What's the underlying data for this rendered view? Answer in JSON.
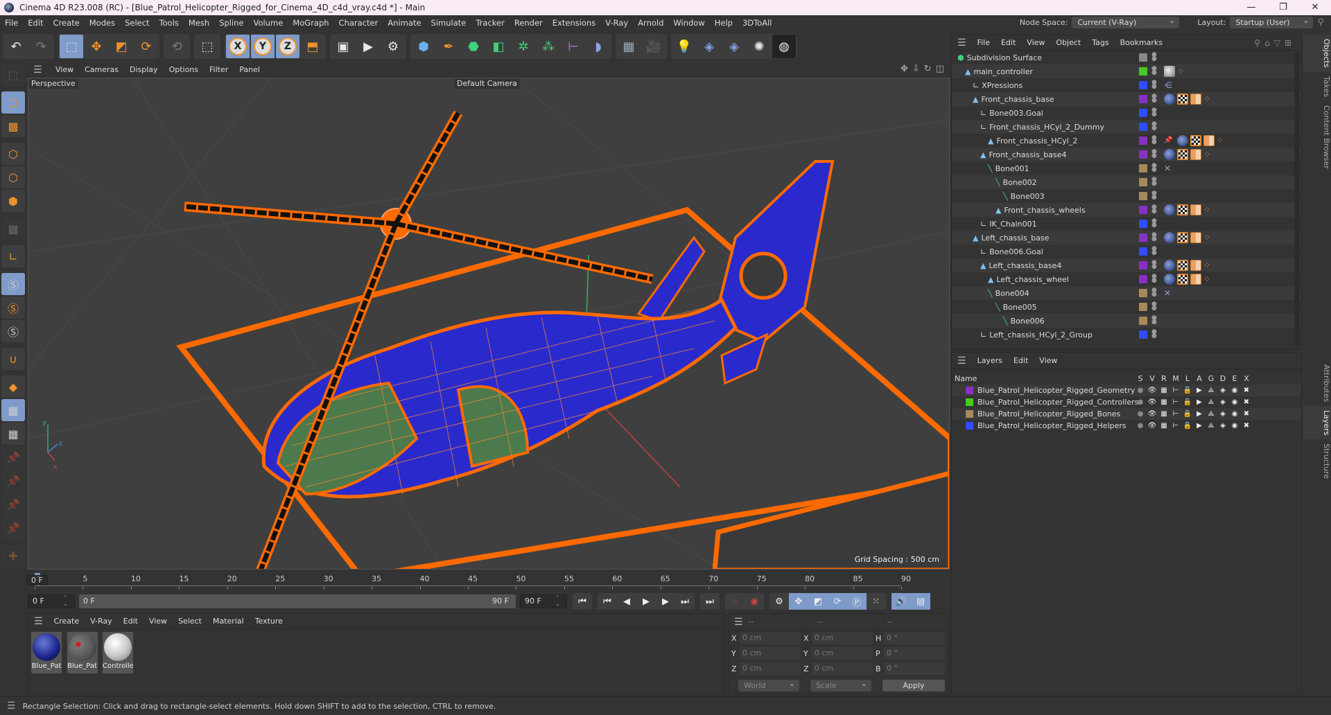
{
  "titlebar": {
    "title": "Cinema 4D R23.008 (RC) - [Blue_Patrol_Helicopter_Rigged_for_Cinema_4D_c4d_vray.c4d *] - Main",
    "minimize": "—",
    "maximize": "❐",
    "close": "✕"
  },
  "menubar": {
    "items": [
      "File",
      "Edit",
      "Create",
      "Modes",
      "Select",
      "Tools",
      "Mesh",
      "Spline",
      "Volume",
      "MoGraph",
      "Character",
      "Animate",
      "Simulate",
      "Tracker",
      "Render",
      "Extensions",
      "V-Ray",
      "Arnold",
      "Window",
      "Help",
      "3DToAll"
    ],
    "node_space_label": "Node Space:",
    "node_space_value": "Current (V-Ray)",
    "layout_label": "Layout:",
    "layout_value": "Startup (User)"
  },
  "viewport": {
    "menu": [
      "View",
      "Cameras",
      "Display",
      "Options",
      "Filter",
      "Panel"
    ],
    "view_name": "Perspective",
    "camera": "Default Camera",
    "grid_spacing": "Grid Spacing : 500 cm"
  },
  "timeline": {
    "ticks": [
      "0",
      "5",
      "10",
      "15",
      "20",
      "25",
      "30",
      "35",
      "40",
      "45",
      "50",
      "55",
      "60",
      "65",
      "70",
      "75",
      "80",
      "85",
      "90"
    ],
    "current_frame_right": "0 F",
    "start_field": "0 F",
    "range_start": "0 F",
    "range_end": "90 F",
    "end_field": "90 F"
  },
  "material_panel": {
    "menu": [
      "Create",
      "V-Ray",
      "Edit",
      "View",
      "Select",
      "Material",
      "Texture"
    ],
    "materials": [
      {
        "name": "Blue_Pat",
        "style": "blue"
      },
      {
        "name": "Blue_Pat",
        "style": "gray-red"
      },
      {
        "name": "Controlle",
        "style": "white"
      }
    ]
  },
  "coordinates": {
    "headers": [
      "--",
      "--",
      "--"
    ],
    "rows": [
      {
        "l1": "X",
        "v1": "0 cm",
        "l2": "X",
        "v2": "0 cm",
        "l3": "H",
        "v3": "0 °"
      },
      {
        "l1": "Y",
        "v1": "0 cm",
        "l2": "Y",
        "v2": "0 cm",
        "l3": "P",
        "v3": "0 °"
      },
      {
        "l1": "Z",
        "v1": "0 cm",
        "l2": "Z",
        "v2": "0 cm",
        "l3": "B",
        "v3": "0 °"
      }
    ],
    "space": "World",
    "mode": "Scale",
    "apply": "Apply"
  },
  "status": {
    "text": "Rectangle Selection: Click and drag to rectangle-select elements. Hold down SHIFT to add to the selection, CTRL to remove."
  },
  "object_manager": {
    "menu": [
      "File",
      "Edit",
      "View",
      "Object",
      "Tags",
      "Bookmarks"
    ],
    "objects": [
      {
        "name": "Subdivision Surface",
        "depth": 0,
        "icon": "subdivision-icon",
        "color": "#888888",
        "tags": []
      },
      {
        "name": "main_controller",
        "depth": 1,
        "icon": "null-icon",
        "color": "#44cc22",
        "tags": [
          "gray",
          "ik"
        ]
      },
      {
        "name": "XPressions",
        "depth": 2,
        "icon": "helper-icon",
        "color": "#2f4cff",
        "tags": [
          "xpresso"
        ]
      },
      {
        "name": "Front_chassis_base",
        "depth": 2,
        "icon": "null-icon",
        "color": "#8a2fc4",
        "tags": [
          "mat",
          "chk",
          "uv",
          "ik"
        ]
      },
      {
        "name": "Bone003.Goal",
        "depth": 3,
        "icon": "helper-icon",
        "color": "#2f4cff",
        "tags": []
      },
      {
        "name": "Front_chassis_HCyl_2_Dummy",
        "depth": 3,
        "icon": "helper-icon",
        "color": "#2f4cff",
        "tags": []
      },
      {
        "name": "Front_chassis_HCyl_2",
        "depth": 4,
        "icon": "null-icon",
        "color": "#8a2fc4",
        "tags": [
          "pin",
          "mat",
          "chk",
          "uv",
          "ik"
        ]
      },
      {
        "name": "Front_chassis_base4",
        "depth": 3,
        "icon": "null-icon",
        "color": "#8a2fc4",
        "tags": [
          "mat",
          "chk",
          "uv",
          "ik"
        ]
      },
      {
        "name": "Bone001",
        "depth": 4,
        "icon": "bone-icon",
        "color": "#a8895a",
        "tags": [
          "ikbone"
        ]
      },
      {
        "name": "Bone002",
        "depth": 5,
        "icon": "bone-icon",
        "color": "#a8895a",
        "tags": []
      },
      {
        "name": "Bone003",
        "depth": 6,
        "icon": "bone-icon",
        "color": "#a8895a",
        "tags": []
      },
      {
        "name": "Front_chassis_wheels",
        "depth": 5,
        "icon": "null-icon",
        "color": "#8a2fc4",
        "tags": [
          "mat",
          "chk",
          "uv",
          "ik"
        ]
      },
      {
        "name": "IK_Chain001",
        "depth": 3,
        "icon": "helper-icon",
        "color": "#2f4cff",
        "tags": []
      },
      {
        "name": "Left_chassis_base",
        "depth": 2,
        "icon": "null-icon",
        "color": "#8a2fc4",
        "tags": [
          "mat",
          "chk",
          "uv",
          "ik"
        ]
      },
      {
        "name": "Bone006.Goal",
        "depth": 3,
        "icon": "helper-icon",
        "color": "#2f4cff",
        "tags": []
      },
      {
        "name": "Left_chassis_base4",
        "depth": 3,
        "icon": "null-icon",
        "color": "#8a2fc4",
        "tags": [
          "mat",
          "chk",
          "uv",
          "ik"
        ]
      },
      {
        "name": "Left_chassis_wheel",
        "depth": 4,
        "icon": "null-icon",
        "color": "#8a2fc4",
        "tags": [
          "mat",
          "chk",
          "uv",
          "ik"
        ]
      },
      {
        "name": "Bone004",
        "depth": 4,
        "icon": "bone-icon",
        "color": "#a8895a",
        "tags": [
          "ikbone"
        ]
      },
      {
        "name": "Bone005",
        "depth": 5,
        "icon": "bone-icon",
        "color": "#a8895a",
        "tags": []
      },
      {
        "name": "Bone006",
        "depth": 6,
        "icon": "bone-icon",
        "color": "#a8895a",
        "tags": []
      },
      {
        "name": "Left_chassis_HCyl_2_Group",
        "depth": 3,
        "icon": "helper-icon",
        "color": "#2f4cff",
        "tags": []
      }
    ]
  },
  "layers_manager": {
    "menu": [
      "Layers",
      "Edit",
      "View"
    ],
    "col_name": "Name",
    "col_flags": [
      "S",
      "V",
      "R",
      "M",
      "L",
      "A",
      "G",
      "D",
      "E",
      "X"
    ],
    "layers": [
      {
        "name": "Blue_Patrol_Helicopter_Rigged_Geometry",
        "color": "#8a2fc4"
      },
      {
        "name": "Blue_Patrol_Helicopter_Rigged_Controllers",
        "color": "#44cc22"
      },
      {
        "name": "Blue_Patrol_Helicopter_Rigged_Bones",
        "color": "#a8895a"
      },
      {
        "name": "Blue_Patrol_Helicopter_Rigged_Helpers",
        "color": "#2f4cff"
      }
    ]
  },
  "right_tabs": {
    "top": [
      "Objects",
      "Takes",
      "Content Browser"
    ],
    "bottom": [
      "Attributes",
      "Layers",
      "Structure"
    ]
  },
  "colors": {
    "accent_selected": "#7f9bc9",
    "wireframe_orange": "#ff6a00",
    "hull_blue": "#2a2acc"
  }
}
